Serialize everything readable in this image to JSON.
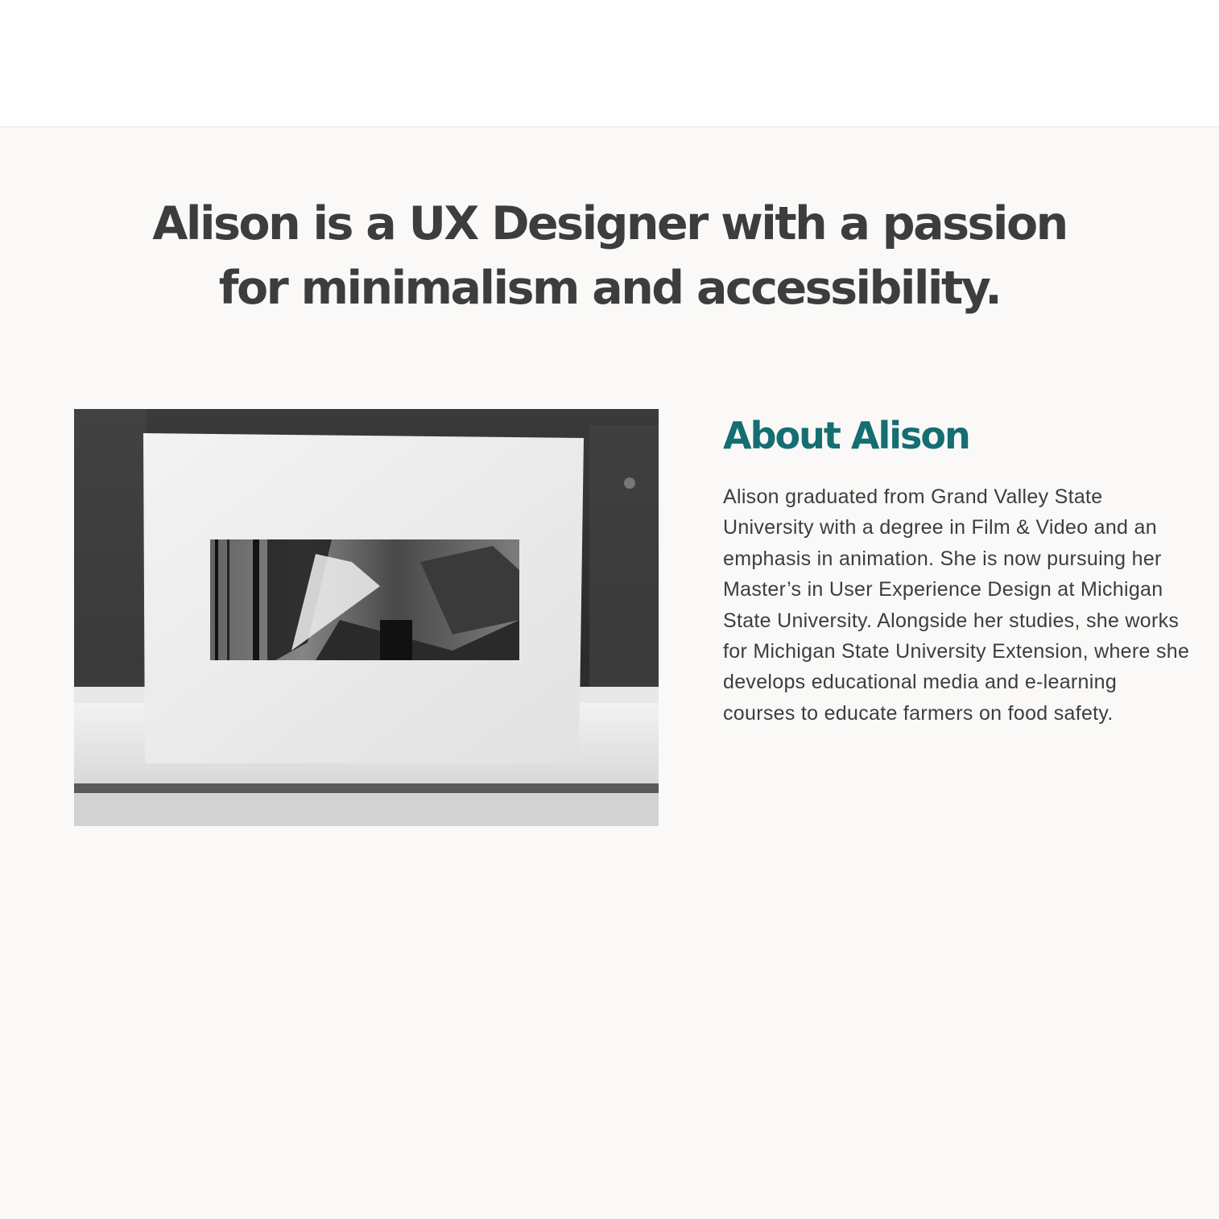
{
  "hero": {
    "headline": "Alison is a UX Designer with a passion for minimalism and accessibility."
  },
  "about": {
    "heading": "About Alison",
    "body": "Alison graduated from Grand Valley State University with a degree in Film & Video and an emphasis in animation. She is now pursuing her Master’s in User Experience Design at Michigan State University. Alongside her studies, she works for Michigan State University Extension, where she develops educational media and e-learning courses to educate farmers on food safety."
  },
  "colors": {
    "background": "#faf9f7",
    "header": "#ffffff",
    "text": "#3d3d3d",
    "accent": "#146e72"
  }
}
